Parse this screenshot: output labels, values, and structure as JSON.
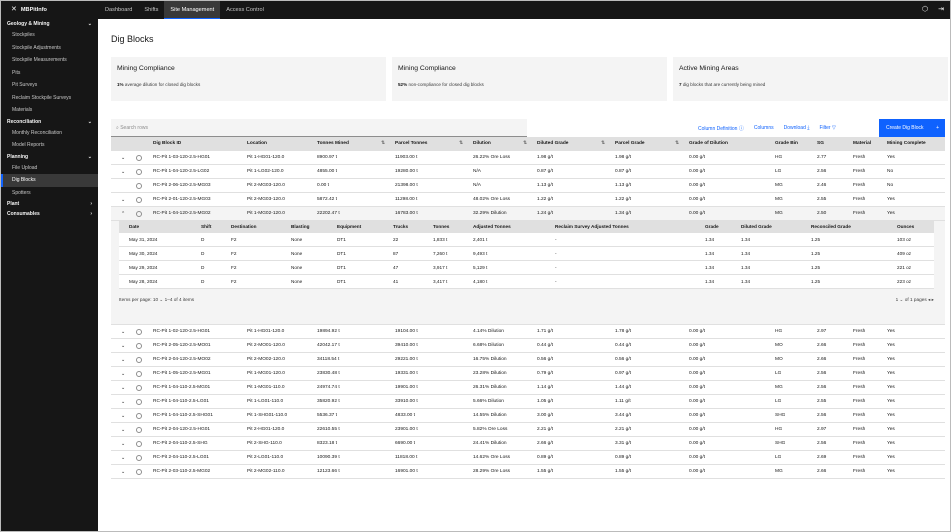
{
  "app": {
    "menu_icon": "menu-icon",
    "name": "MBPitInfo"
  },
  "topnav": [
    "Dashboard",
    "Shifts",
    "Site Management",
    "Access Control"
  ],
  "topnav_active": 2,
  "sidebar": [
    {
      "type": "cat",
      "label": "Geology & Mining",
      "chev": "⌄"
    },
    {
      "type": "item",
      "label": "Stockpiles"
    },
    {
      "type": "item",
      "label": "Stockpile Adjustments"
    },
    {
      "type": "item",
      "label": "Stockpile Measurements"
    },
    {
      "type": "item",
      "label": "Pits"
    },
    {
      "type": "item",
      "label": "Pit Surveys"
    },
    {
      "type": "item",
      "label": "Reclaim Stockpile Surveys"
    },
    {
      "type": "item",
      "label": "Materials"
    },
    {
      "type": "cat",
      "label": "Reconciliation",
      "chev": "⌄"
    },
    {
      "type": "item",
      "label": "Monthly Reconciliation"
    },
    {
      "type": "item",
      "label": "Model Reports"
    },
    {
      "type": "cat",
      "label": "Planning",
      "chev": "⌄"
    },
    {
      "type": "item",
      "label": "File Upload"
    },
    {
      "type": "item",
      "label": "Dig Blocks",
      "active": true
    },
    {
      "type": "item",
      "label": "Spotters"
    },
    {
      "type": "cat",
      "label": "Plant",
      "chev": "›"
    },
    {
      "type": "cat",
      "label": "Consumables",
      "chev": "›"
    }
  ],
  "page": {
    "title": "Dig Blocks"
  },
  "cards": [
    {
      "title": "Mining Compliance",
      "value": "1%",
      "desc": "average dilution for closed dig blocks"
    },
    {
      "title": "Mining Compliance",
      "value": "52%",
      "desc": "non-compliance for closed dig blocks"
    },
    {
      "title": "Active Mining Areas",
      "value": "7",
      "desc": "dig blocks that are currently being mined"
    }
  ],
  "toolbar": {
    "search_placeholder": "Search rows",
    "column_definition": "Column Definition",
    "columns": "Columns",
    "download": "Download",
    "filter": "Filter",
    "create": "Create Dig Block",
    "create_icon": "+"
  },
  "columns": [
    "Dig Block ID",
    "Location",
    "Tonnes Mined",
    "Parcel Tonnes",
    "Dilution",
    "Diluted Grade",
    "Parcel Grade",
    "Grade of Dilution",
    "Grade Bin",
    "SG",
    "Material",
    "Mining Complete"
  ],
  "rows_top": [
    {
      "chev": "⌄",
      "id": "RC-Pit 1-03-120-2.5-HG01",
      "loc": "Pit 1-HG01-120.0",
      "tm": "8900.97 t",
      "pt": "11903.00 t",
      "dil": "26.22% Ore Loss",
      "dg": "1.98 g/t",
      "pg": "1.98 g/t",
      "gd": "0.00 g/t",
      "bin": "HG",
      "sg": "2.77",
      "mat": "Fresh",
      "mc": "Yes"
    },
    {
      "chev": "⌄",
      "id": "RC-Pit 1-04-120-2.5-LG02",
      "loc": "Pit 1-LG02-120.0",
      "tm": "4855.00 t",
      "pt": "19280.00 t",
      "dil": "N/A",
      "dg": "0.87 g/t",
      "pg": "0.87 g/t",
      "gd": "0.00 g/t",
      "bin": "LG",
      "sg": "2.56",
      "mat": "Fresh",
      "mc": "No"
    },
    {
      "chev": "",
      "id": "RC-Pit 2-06-120-2.5-MG03",
      "loc": "Pit 2-MG03-120.0",
      "tm": "0.00 t",
      "pt": "21398.00 t",
      "dil": "N/A",
      "dg": "1.13 g/t",
      "pg": "1.13 g/t",
      "gd": "0.00 g/t",
      "bin": "MG",
      "sg": "2.46",
      "mat": "Fresh",
      "mc": "No"
    },
    {
      "chev": "⌄",
      "id": "RC-Pit 2-01-120-2.5-MG03",
      "loc": "Pit 2-MG03-120.0",
      "tm": "5872.42 t",
      "pt": "11298.00 t",
      "dil": "48.02% Ore Loss",
      "dg": "1.22 g/t",
      "pg": "1.22 g/t",
      "gd": "0.00 g/t",
      "bin": "MG",
      "sg": "2.55",
      "mat": "Fresh",
      "mc": "Yes"
    },
    {
      "chev": "⌃",
      "id": "RC-Pit 1-04-120-2.5-MG02",
      "loc": "Pit 1-MG02-120.0",
      "tm": "22202.47 t",
      "pt": "16783.00 t",
      "dil": "32.29% Dilution",
      "dg": "1.24 g/t",
      "pg": "1.34 g/t",
      "gd": "0.00 g/t",
      "bin": "MG",
      "sg": "2.50",
      "mat": "Fresh",
      "mc": "Yes"
    }
  ],
  "subcolumns": [
    "Date",
    "Shift",
    "Destination",
    "Blasting",
    "Equipment",
    "Trucks",
    "Tonnes",
    "Adjusted Tonnes",
    "Reclaim Survey Adjusted Tonnes",
    "Grade",
    "Diluted Grade",
    "Reconciled Grade",
    "Ounces"
  ],
  "subrows": [
    {
      "date": "May 31, 2024",
      "shift": "D",
      "dest": "F2",
      "blast": "None",
      "eq": "DT1",
      "trucks": "22",
      "tonnes": "1,833 t",
      "adj": "2,401 t",
      "rsat": "-",
      "grade": "1.34",
      "dg": "1.34",
      "rg": "1.25",
      "oz": "103 oz"
    },
    {
      "date": "May 30, 2024",
      "shift": "D",
      "dest": "F2",
      "blast": "None",
      "eq": "DT1",
      "trucks": "87",
      "tonnes": "7,260 t",
      "adj": "9,493 t",
      "rsat": "-",
      "grade": "1.34",
      "dg": "1.34",
      "rg": "1.25",
      "oz": "409 oz"
    },
    {
      "date": "May 29, 2024",
      "shift": "D",
      "dest": "F2",
      "blast": "None",
      "eq": "DT1",
      "trucks": "47",
      "tonnes": "3,917 t",
      "adj": "5,129 t",
      "rsat": "-",
      "grade": "1.34",
      "dg": "1.34",
      "rg": "1.25",
      "oz": "221 oz"
    },
    {
      "date": "May 28, 2024",
      "shift": "D",
      "dest": "F2",
      "blast": "None",
      "eq": "DT1",
      "trucks": "41",
      "tonnes": "3,417 t",
      "adj": "4,180 t",
      "rsat": "-",
      "grade": "1.34",
      "dg": "1.34",
      "rg": "1.25",
      "oz": "223 oz"
    }
  ],
  "subpager": {
    "items_label": "Items per page:",
    "per_page": "10",
    "range": "1–4 of 4 items",
    "page": "1",
    "of_pages": "of 1 pages"
  },
  "rows_bottom": [
    {
      "chev": "⌄",
      "id": "RC-Pit 1-02-120-2.5-HG01",
      "loc": "Pit 1-HG01-120.0",
      "tm": "19894.92 t",
      "pt": "19104.00 t",
      "dil": "4.14% Dilution",
      "dg": "1.71 g/t",
      "pg": "1.78 g/t",
      "gd": "0.00 g/t",
      "bin": "HG",
      "sg": "2.97",
      "mat": "Fresh",
      "mc": "Yes"
    },
    {
      "chev": "⌄",
      "id": "RC-Pit 2-05-120-2.5-MO01",
      "loc": "Pit 2-MO01-120.0",
      "tm": "42042.17 t",
      "pt": "39410.00 t",
      "dil": "6.68% Dilution",
      "dg": "0.44 g/t",
      "pg": "0.44 g/t",
      "gd": "0.00 g/t",
      "bin": "MO",
      "sg": "2.66",
      "mat": "Fresh",
      "mc": "Yes"
    },
    {
      "chev": "⌄",
      "id": "RC-Pit 2-04-120-2.5-MO02",
      "loc": "Pit 2-MO02-120.0",
      "tm": "34118.54 t",
      "pt": "29221.00 t",
      "dil": "16.75% Dilution",
      "dg": "0.56 g/t",
      "pg": "0.56 g/t",
      "gd": "0.00 g/t",
      "bin": "MO",
      "sg": "2.66",
      "mat": "Fresh",
      "mc": "Yes"
    },
    {
      "chev": "⌄",
      "id": "RC-Pit 1-05-120-2.5-MG01",
      "loc": "Pit 1-MG01-120.0",
      "tm": "23830.48 t",
      "pt": "19331.00 t",
      "dil": "23.28% Dilution",
      "dg": "0.79 g/t",
      "pg": "0.97 g/t",
      "gd": "0.00 g/t",
      "bin": "LG",
      "sg": "2.56",
      "mat": "Fresh",
      "mc": "Yes"
    },
    {
      "chev": "⌄",
      "id": "RC-Pit 1-04-110-2.5-MG01",
      "loc": "Pit 1-MG01-110.0",
      "tm": "24974.74 t",
      "pt": "19901.00 t",
      "dil": "26.31% Dilution",
      "dg": "1.14 g/t",
      "pg": "1.44 g/t",
      "gd": "0.00 g/t",
      "bin": "MG",
      "sg": "2.56",
      "mat": "Fresh",
      "mc": "Yes"
    },
    {
      "chev": "⌄",
      "id": "RC-Pit 1-04-110-2.5-LG01",
      "loc": "Pit 1-LG01-110.0",
      "tm": "35820.92 t",
      "pt": "33910.00 t",
      "dil": "5.66% Dilution",
      "dg": "1.05 g/t",
      "pg": "1.11 g/t",
      "gd": "0.00 g/t",
      "bin": "LG",
      "sg": "2.55",
      "mat": "Fresh",
      "mc": "Yes"
    },
    {
      "chev": "⌄",
      "id": "RC-Pit 1-04-110-2.5-SHG01",
      "loc": "Pit 1-SHG01-110.0",
      "tm": "5536.37 t",
      "pt": "4833.00 t",
      "dil": "14.55% Dilution",
      "dg": "3.00 g/t",
      "pg": "3.44 g/t",
      "gd": "0.00 g/t",
      "bin": "SHG",
      "sg": "2.56",
      "mat": "Fresh",
      "mc": "Yes"
    },
    {
      "chev": "⌄",
      "id": "RC-Pit 2-04-120-2.5-HG01",
      "loc": "Pit 2-HG01-120.0",
      "tm": "22610.55 t",
      "pt": "23901.00 t",
      "dil": "5.82% Ore Loss",
      "dg": "2.21 g/t",
      "pg": "2.21 g/t",
      "gd": "0.00 g/t",
      "bin": "HG",
      "sg": "2.97",
      "mat": "Fresh",
      "mc": "Yes"
    },
    {
      "chev": "⌄",
      "id": "RC-Pit 2-04-110-2.5-SHG",
      "loc": "Pit 2-SHG-110.0",
      "tm": "8323.18 t",
      "pt": "6690.00 t",
      "dil": "24.41% Dilution",
      "dg": "2.66 g/t",
      "pg": "3.31 g/t",
      "gd": "0.00 g/t",
      "bin": "SHG",
      "sg": "2.56",
      "mat": "Fresh",
      "mc": "Yes"
    },
    {
      "chev": "⌄",
      "id": "RC-Pit 2-04-110-2.5-LG01",
      "loc": "Pit 2-LG01-110.0",
      "tm": "10090.39 t",
      "pt": "11818.00 t",
      "dil": "14.62% Ore Loss",
      "dg": "0.89 g/t",
      "pg": "0.89 g/t",
      "gd": "0.00 g/t",
      "bin": "LG",
      "sg": "2.69",
      "mat": "Fresh",
      "mc": "Yes"
    },
    {
      "chev": "⌄",
      "id": "RC-Pit 2-03-110-2.5-MG02",
      "loc": "Pit 2-MG02-110.0",
      "tm": "12123.66 t",
      "pt": "16901.00 t",
      "dil": "28.29% Ore Loss",
      "dg": "1.55 g/t",
      "pg": "1.55 g/t",
      "gd": "0.00 g/t",
      "bin": "MG",
      "sg": "2.66",
      "mat": "Fresh",
      "mc": "Yes"
    }
  ]
}
